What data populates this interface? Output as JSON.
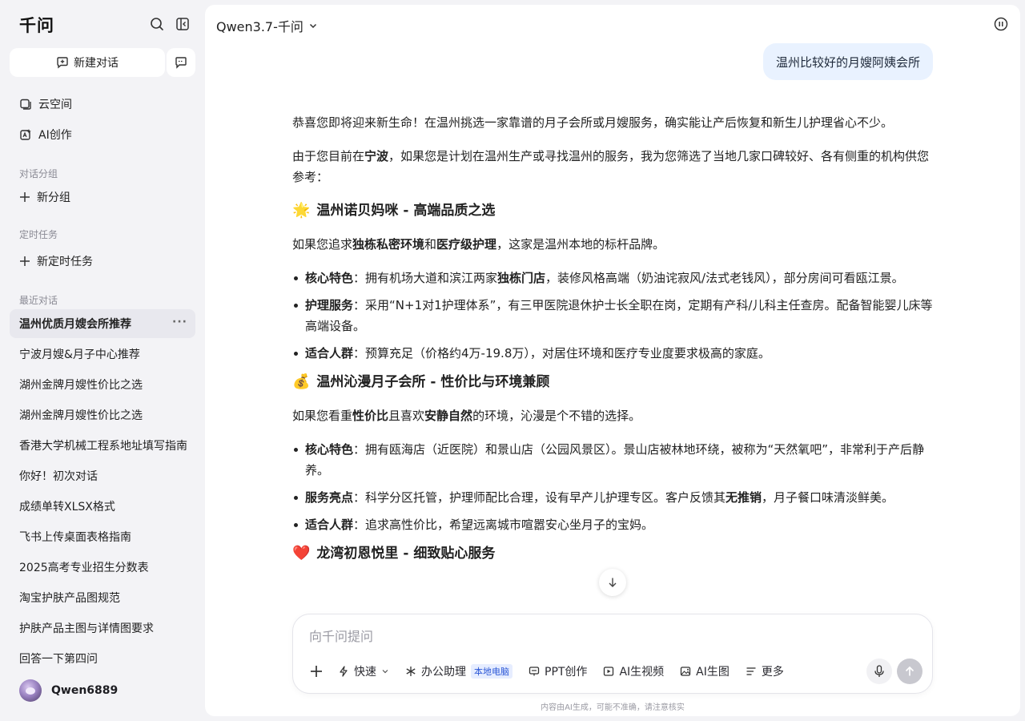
{
  "sidebar": {
    "logo": "千问",
    "new_chat_label": "新建对话",
    "nav": [
      {
        "label": "云空间",
        "icon": "cloud-space-icon"
      },
      {
        "label": "AI创作",
        "icon": "ai-create-icon"
      }
    ],
    "group_section_label": "对话分组",
    "new_group_label": "新分组",
    "task_section_label": "定时任务",
    "new_task_label": "新定时任务",
    "recent_section_label": "最近对话",
    "recent": [
      {
        "label": "温州优质月嫂会所推荐",
        "active": true
      },
      {
        "label": "宁波月嫂&月子中心推荐"
      },
      {
        "label": "湖州金牌月嫂性价比之选"
      },
      {
        "label": "湖州金牌月嫂性价比之选"
      },
      {
        "label": "香港大学机械工程系地址填写指南"
      },
      {
        "label": "你好！初次对话"
      },
      {
        "label": "成绩单转XLSX格式"
      },
      {
        "label": "飞书上传桌面表格指南"
      },
      {
        "label": "2025高考专业招生分数表"
      },
      {
        "label": "淘宝护肤产品图规范"
      },
      {
        "label": "护肤产品主图与详情图要求"
      },
      {
        "label": "回答一下第四问"
      }
    ],
    "more_dots": "···",
    "username": "Qwen6889"
  },
  "header": {
    "model": "Qwen3.7-千问"
  },
  "chat": {
    "user_message": "温州比较好的月嫂阿姨会所",
    "intro": "恭喜您即将迎来新生命！在温州挑选一家靠谱的月子会所或月嫂服务，确实能让产后恢复和新生儿护理省心不少。",
    "intro2_a": "由于您目前在",
    "intro2_b": "宁波",
    "intro2_c": "，如果您是计划在温州生产或寻找温州的服务，我为您筛选了当地几家口碑较好、各有侧重的机构供您参考：",
    "s1": {
      "emoji": "🌟",
      "title": "温州诺贝妈咪 - 高端品质之选",
      "desc_a": "如果您追求",
      "desc_b": "独栋私密环境",
      "desc_c": "和",
      "desc_d": "医疗级护理",
      "desc_e": "，这家是温州本地的标杆品牌。",
      "b1_k": "核心特色",
      "b1_a": "：拥有机场大道和滨江两家",
      "b1_b": "独栋门店",
      "b1_c": "，装修风格高端（奶油诧寂风/法式老钱风），部分房间可看瓯江景。",
      "b2_k": "护理服务",
      "b2_a": "：采用“N+1对1护理体系”，有三甲医院退休护士长全职在岗，定期有产科/儿科主任查房。配备智能婴儿床等高端设备。",
      "b3_k": "适合人群",
      "b3_a": "：预算充足（价格约4万-19.8万），对居住环境和医疗专业度要求极高的家庭。"
    },
    "s2": {
      "emoji": "💰",
      "title": "温州沁漫月子会所 - 性价比与环境兼顾",
      "desc_a": "如果您看重",
      "desc_b": "性价比",
      "desc_c": "且喜欢",
      "desc_d": "安静自然",
      "desc_e": "的环境，沁漫是个不错的选择。",
      "b1_k": "核心特色",
      "b1_a": "：拥有瓯海店（近医院）和景山店（公园风景区）。景山店被林地环绕，被称为“天然氧吧”，非常利于产后静养。",
      "b2_k": "服务亮点",
      "b2_a": "：科学分区托管，护理师配比合理，设有早产儿护理专区。客户反馈其",
      "b2_b": "无推销",
      "b2_c": "，月子餐口味清淡鲜美。",
      "b3_k": "适合人群",
      "b3_a": "：追求高性价比，希望远离城市喧嚣安心坐月子的宝妈。"
    },
    "s3": {
      "emoji": "❤️",
      "title": "龙湾初恩悦里 - 细致贴心服务"
    }
  },
  "composer": {
    "placeholder": "向千问提问",
    "tools": {
      "fast": "快速",
      "office": "办公助理",
      "office_badge": "本地电脑",
      "ppt": "PPT创作",
      "video": "AI生视频",
      "image": "AI生图",
      "more": "更多"
    },
    "disclaimer": "内容由AI生成，可能不准确，请注意核实"
  },
  "colors": {
    "accent_bubble": "#e9f2ff",
    "badge_blue": "#2a56d6",
    "sidebar_bg": "#f3f3f6"
  }
}
